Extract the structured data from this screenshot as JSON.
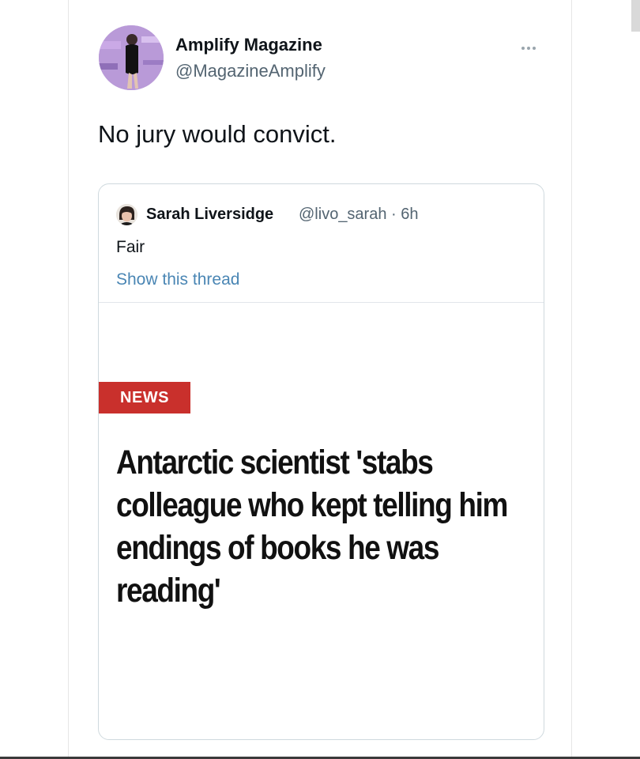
{
  "tweet": {
    "author_name": "Amplify Magazine",
    "author_handle": "@MagazineAmplify",
    "text": "No jury would convict.",
    "more_icon": "more-horizontal-icon"
  },
  "quoted_tweet": {
    "author_name": "Sarah Liversidge",
    "handle_time": "@livo_sarah · 6h",
    "text": "Fair",
    "show_thread": "Show this thread",
    "media": {
      "badge": "NEWS",
      "headline": "Antarctic scientist 'stabs colleague who kept telling him endings of books he was reading'",
      "badge_color": "#c9302c"
    }
  }
}
